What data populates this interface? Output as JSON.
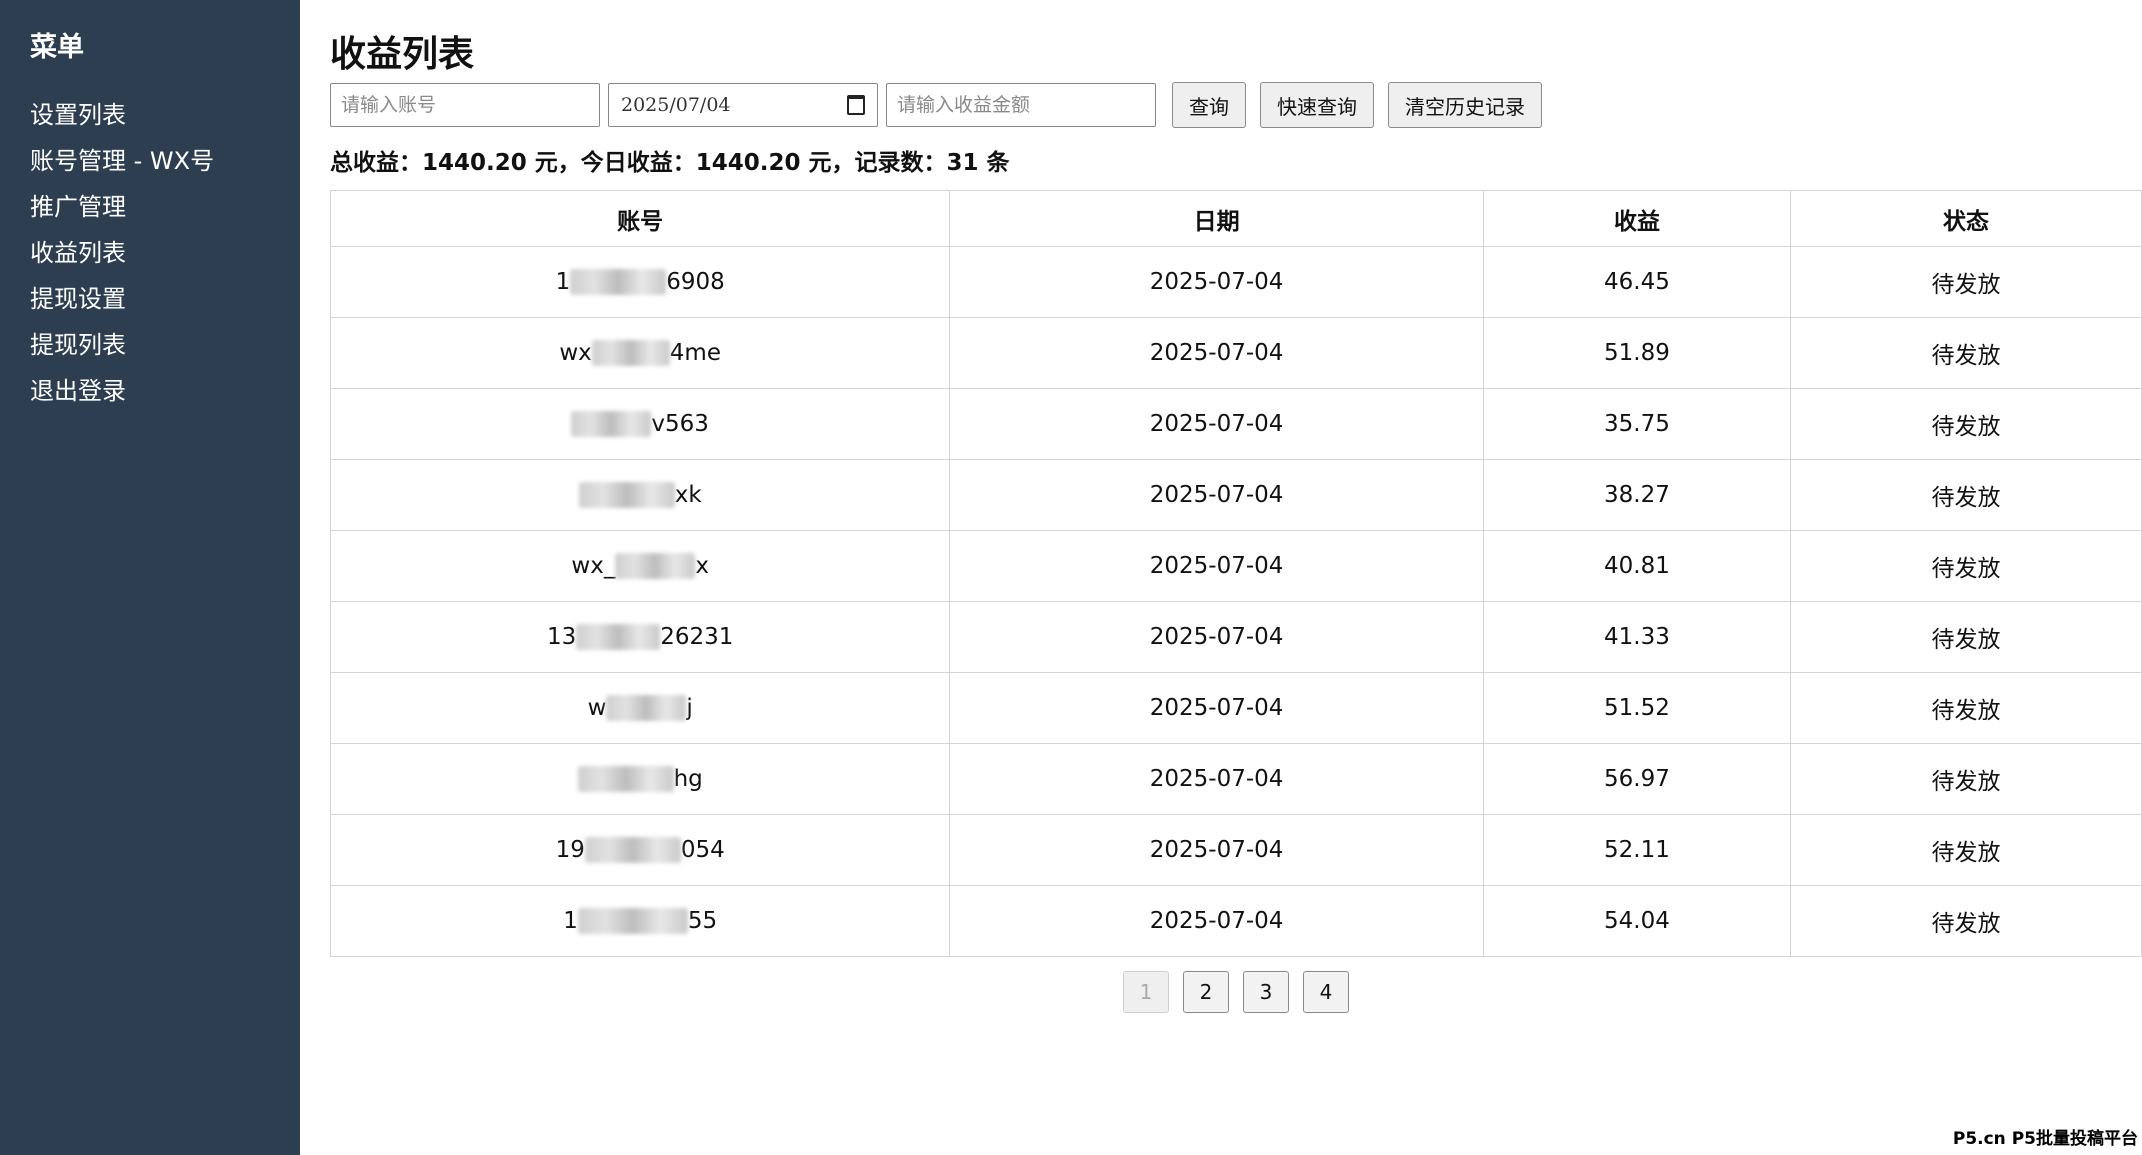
{
  "sidebar": {
    "title": "菜单",
    "items": [
      {
        "label": "设置列表"
      },
      {
        "label": "账号管理 - WX号"
      },
      {
        "label": "推广管理"
      },
      {
        "label": "收益列表"
      },
      {
        "label": "提现设置"
      },
      {
        "label": "提现列表"
      },
      {
        "label": "退出登录"
      }
    ]
  },
  "page": {
    "title": "收益列表"
  },
  "filters": {
    "account_placeholder": "请输入账号",
    "date_value": "2025/07/04",
    "amount_placeholder": "请输入收益金额",
    "query_label": "查询",
    "quick_query_label": "快速查询",
    "clear_history_label": "清空历史记录"
  },
  "summary": {
    "text": "总收益：1440.20 元，今日收益：1440.20 元，记录数：31 条"
  },
  "table": {
    "headers": {
      "account": "账号",
      "date": "日期",
      "amount": "收益",
      "status": "状态"
    },
    "rows": [
      {
        "acc_pre": "1",
        "acc_suf": "6908",
        "date": "2025-07-04",
        "amount": "46.45",
        "status": "待发放"
      },
      {
        "acc_pre": "wx",
        "acc_suf": "4me",
        "date": "2025-07-04",
        "amount": "51.89",
        "status": "待发放"
      },
      {
        "acc_pre": "",
        "acc_suf": "v563",
        "date": "2025-07-04",
        "amount": "35.75",
        "status": "待发放"
      },
      {
        "acc_pre": "",
        "acc_suf": "xk",
        "date": "2025-07-04",
        "amount": "38.27",
        "status": "待发放"
      },
      {
        "acc_pre": "wx_",
        "acc_suf": "x",
        "date": "2025-07-04",
        "amount": "40.81",
        "status": "待发放"
      },
      {
        "acc_pre": "13",
        "acc_suf": "26231",
        "date": "2025-07-04",
        "amount": "41.33",
        "status": "待发放"
      },
      {
        "acc_pre": "w",
        "acc_suf": "j",
        "date": "2025-07-04",
        "amount": "51.52",
        "status": "待发放"
      },
      {
        "acc_pre": "",
        "acc_suf": "hg",
        "date": "2025-07-04",
        "amount": "56.97",
        "status": "待发放"
      },
      {
        "acc_pre": "19",
        "acc_suf": "054",
        "date": "2025-07-04",
        "amount": "52.11",
        "status": "待发放"
      },
      {
        "acc_pre": "1",
        "acc_suf": "55",
        "date": "2025-07-04",
        "amount": "54.04",
        "status": "待发放"
      }
    ]
  },
  "pagination": {
    "pages": [
      "1",
      "2",
      "3",
      "4"
    ]
  },
  "watermark": {
    "text": "P5.cn P5批量投稿平台"
  }
}
